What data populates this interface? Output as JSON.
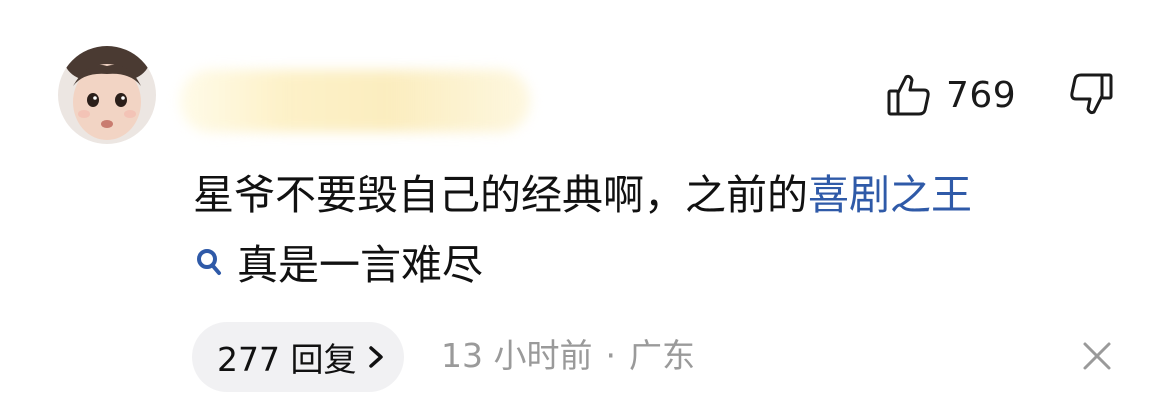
{
  "avatar": {
    "icon": "child-face-avatar"
  },
  "username": {
    "state": "blurred"
  },
  "actions": {
    "like_count": "769",
    "like_icon": "thumbs-up-outline-icon",
    "dislike_icon": "thumbs-down-outline-icon"
  },
  "comment": {
    "text_before": "星爷不要毁自己的经典啊，之前的",
    "keyword": "喜剧之王",
    "search_icon": "search-icon",
    "text_after": "真是一言难尽"
  },
  "footer": {
    "replies_label": "277 回复",
    "time": "13 小时前",
    "separator": "·",
    "location": "广东",
    "close_icon": "close-icon"
  },
  "colors": {
    "keyword": "#2f5aa8",
    "meta": "#9a9a9a",
    "pill_bg": "#f1f1f3"
  }
}
